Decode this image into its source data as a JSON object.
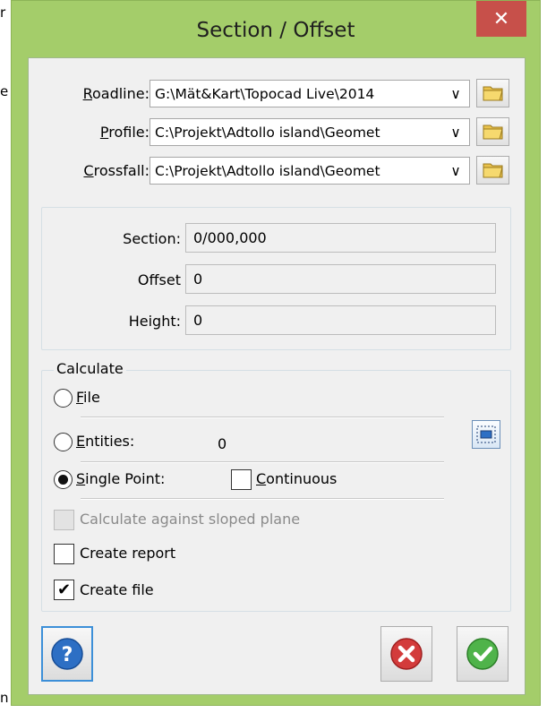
{
  "background_fragments": [
    "r",
    "e",
    "n"
  ],
  "window": {
    "title": "Section / Offset",
    "close_glyph": "✕",
    "title_color": "#a4cd6a"
  },
  "paths": [
    {
      "label_underline": "R",
      "label_rest": "oadline:",
      "value": "G:\\Mät&Kart\\Topocad Live\\2014"
    },
    {
      "label_underline": "P",
      "label_rest": "rofile:",
      "value": "C:\\Projekt\\Adtollo island\\Geomet"
    },
    {
      "label_underline": "C",
      "label_rest": "rossfall:",
      "value": "C:\\Projekt\\Adtollo island\\Geomet"
    }
  ],
  "dropdown_glyph": "∨",
  "position_fields": [
    {
      "label": "Section:",
      "value": "0/000,000"
    },
    {
      "label": "Offset",
      "value": "0"
    },
    {
      "label": "Height:",
      "value": "0"
    }
  ],
  "calculate": {
    "legend": "Calculate",
    "file": {
      "underline": "F",
      "rest": "ile",
      "checked": false
    },
    "entities": {
      "underline": "E",
      "rest": "ntities:",
      "count": "0",
      "checked": false
    },
    "single_point": {
      "underline": "S",
      "rest": "ingle Point:",
      "checked": true
    },
    "continuous": {
      "underline": "C",
      "rest": "ontinuous",
      "checked": false
    },
    "sloped_plane": {
      "label": "Calculate against sloped plane",
      "enabled": false,
      "checked": false
    },
    "create_report": {
      "label": "Create report",
      "checked": false
    },
    "create_file": {
      "label": "Create file",
      "checked": true
    }
  },
  "check_glyph": "✔",
  "colors": {
    "frame": "#a4cd6a",
    "close": "#c7504a",
    "help_blue": "#2d6fc4",
    "cancel_red": "#d33b3b",
    "ok_green": "#4fb34a"
  },
  "icons": {
    "folder": "folder-icon",
    "help": "help-icon",
    "cancel": "cancel-icon",
    "ok": "ok-icon",
    "select": "select-window-icon"
  }
}
